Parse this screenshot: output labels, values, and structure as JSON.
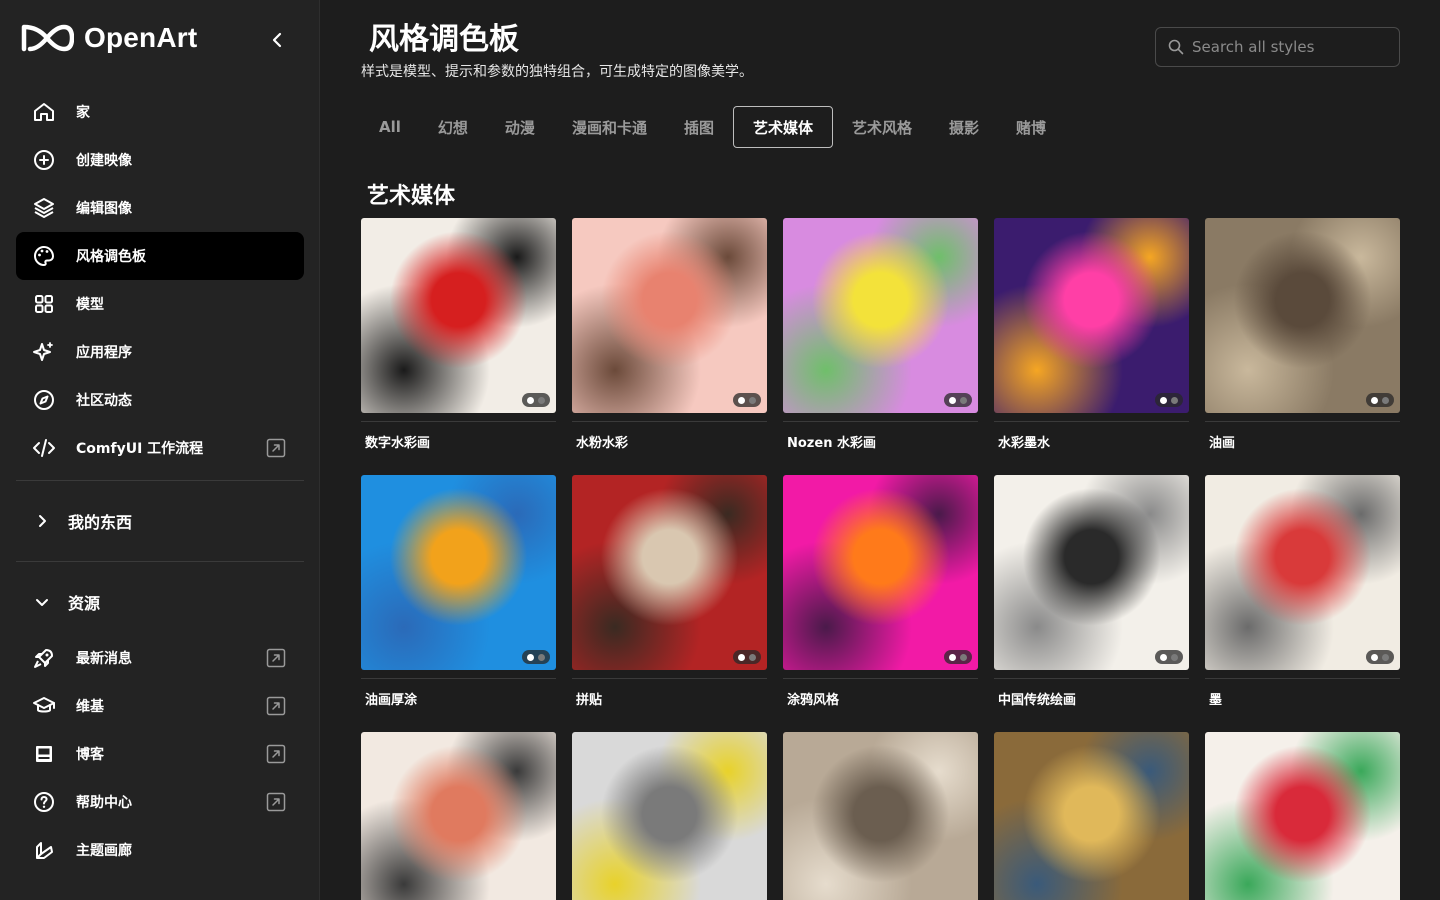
{
  "brand": {
    "name": "OpenArt"
  },
  "nav": {
    "items": [
      {
        "label": "家",
        "icon": "home-icon",
        "active": false,
        "external": false
      },
      {
        "label": "创建映像",
        "icon": "plus-circle-icon",
        "active": false,
        "external": false
      },
      {
        "label": "编辑图像",
        "icon": "layers-icon",
        "active": false,
        "external": false
      },
      {
        "label": "风格调色板",
        "icon": "palette-icon",
        "active": true,
        "external": false
      },
      {
        "label": "模型",
        "icon": "grid-icon",
        "active": false,
        "external": false
      },
      {
        "label": "应用程序",
        "icon": "sparkle-icon",
        "active": false,
        "external": false
      },
      {
        "label": "社区动态",
        "icon": "compass-icon",
        "active": false,
        "external": false
      },
      {
        "label": "ComfyUI 工作流程",
        "icon": "code-icon",
        "active": false,
        "external": true
      }
    ]
  },
  "my_stuff": {
    "label": "我的东西"
  },
  "resources": {
    "label": "资源",
    "items": [
      {
        "label": "最新消息",
        "icon": "rocket-icon",
        "external": true
      },
      {
        "label": "维基",
        "icon": "graduation-cap-icon",
        "external": true
      },
      {
        "label": "博客",
        "icon": "newspaper-icon",
        "external": true
      },
      {
        "label": "帮助中心",
        "icon": "question-circle-icon",
        "external": true
      },
      {
        "label": "主题画廊",
        "icon": "brush-icon",
        "external": false
      }
    ]
  },
  "header": {
    "title": "风格调色板",
    "subtitle": "样式是模型、提示和参数的独特组合，可生成特定的图像美学。",
    "search_placeholder": "Search all styles"
  },
  "tabs": [
    {
      "label": "All",
      "active": false
    },
    {
      "label": "幻想",
      "active": false
    },
    {
      "label": "动漫",
      "active": false
    },
    {
      "label": "漫画和卡通",
      "active": false
    },
    {
      "label": "插图",
      "active": false
    },
    {
      "label": "艺术媒体",
      "active": true
    },
    {
      "label": "艺术风格",
      "active": false
    },
    {
      "label": "摄影",
      "active": false
    },
    {
      "label": "赌博",
      "active": false
    }
  ],
  "section": {
    "title": "艺术媒体"
  },
  "styles": [
    {
      "label": "数字水彩画",
      "colors": [
        "#f2ede6",
        "#d61f1f",
        "#1a1a1a"
      ]
    },
    {
      "label": "水粉水彩",
      "colors": [
        "#f6c9c0",
        "#e8826f",
        "#6b4a3a"
      ]
    },
    {
      "label": "Nozen 水彩画",
      "colors": [
        "#d88be0",
        "#f3e23a",
        "#6fbf6a"
      ]
    },
    {
      "label": "水彩墨水",
      "colors": [
        "#3b1c6e",
        "#ff3fa6",
        "#f5a623"
      ]
    },
    {
      "label": "油画",
      "colors": [
        "#8a7a64",
        "#5a4a3b",
        "#c9b89c"
      ]
    },
    {
      "label": "油画厚涂",
      "colors": [
        "#1f8fe0",
        "#f2a21b",
        "#2b6ab8"
      ]
    },
    {
      "label": "拼贴",
      "colors": [
        "#b32424",
        "#d9c7b0",
        "#3a2a22"
      ]
    },
    {
      "label": "涂鸦风格",
      "colors": [
        "#f21aa6",
        "#ff7a1a",
        "#4a1a4a"
      ]
    },
    {
      "label": "中国传统绘画",
      "colors": [
        "#f3f0ea",
        "#2a2a2a",
        "#8a8a8a"
      ]
    },
    {
      "label": "墨",
      "colors": [
        "#f1ece3",
        "#d93a3a",
        "#6b6b6b"
      ]
    },
    {
      "label": "",
      "colors": [
        "#f2e9e1",
        "#e07a5f",
        "#3a3a3a"
      ]
    },
    {
      "label": "",
      "colors": [
        "#d9d9d9",
        "#7a7a7a",
        "#e8d22a"
      ]
    },
    {
      "label": "",
      "colors": [
        "#b8a996",
        "#6b5e50",
        "#e6dccd"
      ]
    },
    {
      "label": "",
      "colors": [
        "#8a6a3a",
        "#e0b85a",
        "#3a5a7a"
      ]
    },
    {
      "label": "",
      "colors": [
        "#f5f0ea",
        "#d92a3a",
        "#3aa85a"
      ]
    }
  ]
}
